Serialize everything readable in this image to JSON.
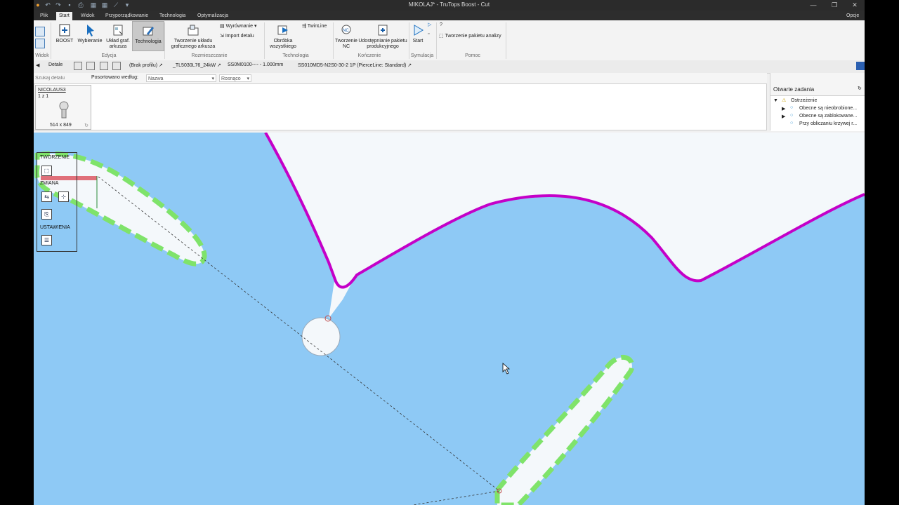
{
  "titlebar": {
    "title": "MIKOLAJ* - TruTops Boost - Cut",
    "options_label": "Opcje"
  },
  "tabs": [
    {
      "label": "Plik"
    },
    {
      "label": "Start"
    },
    {
      "label": "Widok"
    },
    {
      "label": "Przyporządkowanie"
    },
    {
      "label": "Technologia"
    },
    {
      "label": "Optymalizacja"
    }
  ],
  "ribbon": {
    "boost": "BOOST",
    "select": "Wybieranie",
    "sheet_layout": "Układ graf. arkusza",
    "technology": "Technologia",
    "create_layout": "Tworzenie układu graficznego arkusza",
    "align": "Wyrównanie",
    "import_part": "Import detalu",
    "process_all": "Obróbka wszystkiego",
    "twinline": "TwinLine",
    "create_nc": "Tworzenie NC",
    "share_package": "Udostępnianie pakietu produkcyjnego",
    "start": "Start",
    "analysis_package": "Tworzenie pakietu analizy",
    "groups": {
      "view": "Widok",
      "edit": "Edycja",
      "arrange": "Rozmieszczanie",
      "technology": "Technologia",
      "finish": "Kończenie",
      "simulation": "Symulacja",
      "help": "Pomoc"
    }
  },
  "toolbar": {
    "details": "Detale",
    "profile": "(Brak profilu)",
    "machine": "_TL5030L76_24kW",
    "material": "SS0M0100---- - 1.000mm",
    "technology_table": "SS010MD5-N2S0-30-2 1P (PierceLine: Standard)"
  },
  "filter": {
    "search_placeholder": "Szukaj detalu",
    "sorted_by": "Posortowano według:",
    "sort_field": "Nazwa",
    "sort_order": "Rosnąco"
  },
  "part_card": {
    "name": "NICOLAUS3",
    "count": "1 z 1",
    "size": "514 x 849"
  },
  "open_tasks": {
    "title": "Otwarte zadania",
    "root": "Ostrzeżenie",
    "items": [
      {
        "label": "Obecne są nieobrobione..."
      },
      {
        "label": "Obecne są zablokowane..."
      },
      {
        "label": "Przy obliczaniu krzywej r..."
      }
    ]
  },
  "palette": {
    "create": "TWORZENIE",
    "change": "ZMIANA",
    "settings": "USTAWIENIA"
  },
  "colors": {
    "canvas": "#8ec9f5",
    "contour_magenta": "#c400c8",
    "contour_green": "#7fe36a",
    "sheet": "#f4f8fb"
  }
}
